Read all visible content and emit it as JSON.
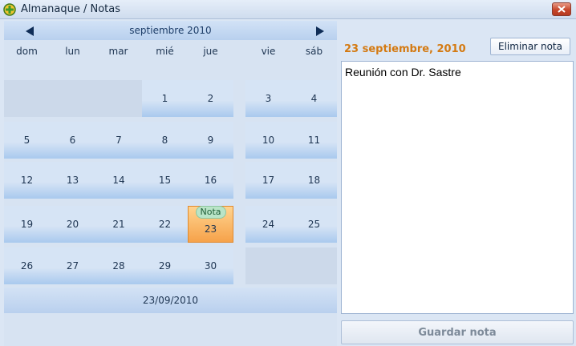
{
  "window": {
    "title": "Almanaque / Notas"
  },
  "calendar": {
    "month_title": "septiembre 2010",
    "weekdays": [
      "dom",
      "lun",
      "mar",
      "mié",
      "jue",
      "vie",
      "sáb"
    ],
    "weeks": [
      [
        "",
        "",
        "",
        "1",
        "2",
        "3",
        "4"
      ],
      [
        "5",
        "6",
        "7",
        "8",
        "9",
        "10",
        "11"
      ],
      [
        "12",
        "13",
        "14",
        "15",
        "16",
        "17",
        "18"
      ],
      [
        "19",
        "20",
        "21",
        "22",
        "23",
        "24",
        "25"
      ],
      [
        "26",
        "27",
        "28",
        "29",
        "30",
        "",
        ""
      ]
    ],
    "selected_day": "23",
    "note_badge": "Nota",
    "footer_date": "23/09/2010"
  },
  "note": {
    "date_heading": "23 septiembre, 2010",
    "delete_label": "Eliminar nota",
    "text": "Reunión con Dr. Sastre",
    "save_label": "Guardar nota"
  },
  "colors": {
    "accent_orange": "#d47a12",
    "selected_day": "#f6a24a",
    "note_badge": "#b9e4c7"
  }
}
